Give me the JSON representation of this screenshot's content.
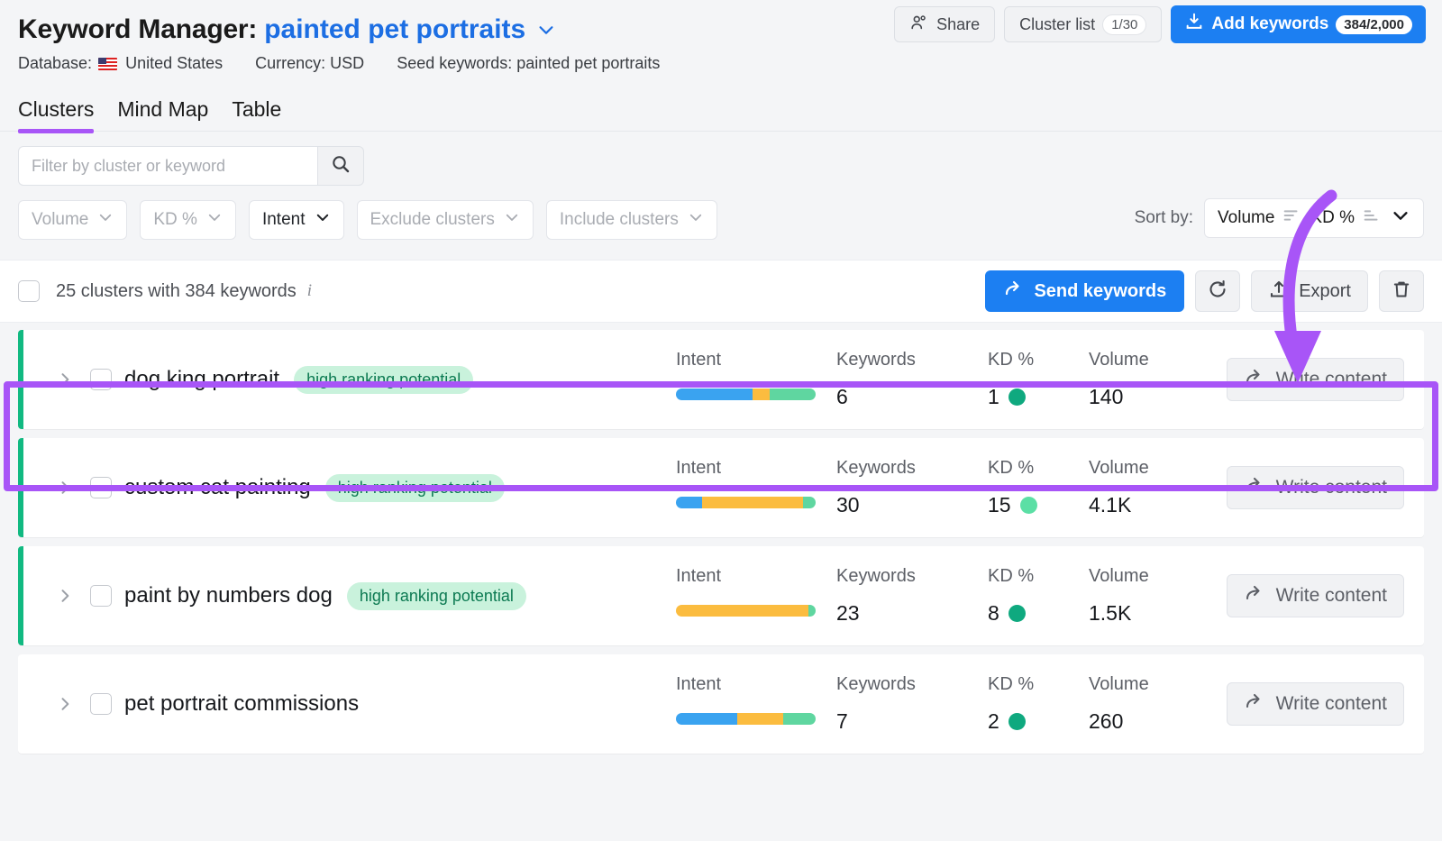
{
  "header": {
    "title": "Keyword Manager:",
    "project": "painted pet portraits",
    "chevron_icon": "chevron-down-icon",
    "share_label": "Share",
    "share_icon": "people-icon",
    "cluster_list_label": "Cluster list",
    "cluster_list_count": "1/30",
    "add_keywords_label": "Add keywords",
    "add_keywords_count": "384/2,000",
    "add_keywords_icon": "download-icon",
    "meta": {
      "database_label": "Database:",
      "database_value": "United States",
      "currency": "Currency: USD",
      "seed": "Seed keywords: painted pet portraits"
    }
  },
  "tabs": [
    {
      "label": "Clusters",
      "active": true
    },
    {
      "label": "Mind Map",
      "active": false
    },
    {
      "label": "Table",
      "active": false
    }
  ],
  "filters": {
    "search_placeholder": "Filter by cluster or keyword",
    "search_value": "",
    "search_icon": "search-icon",
    "chips": [
      {
        "label": "Volume",
        "enabled": false
      },
      {
        "label": "KD %",
        "enabled": false
      },
      {
        "label": "Intent",
        "enabled": true
      },
      {
        "label": "Exclude clusters",
        "enabled": false
      },
      {
        "label": "Include clusters",
        "enabled": false
      }
    ],
    "sort_by_label": "Sort by:",
    "sort_primary": "Volume",
    "sort_secondary": "KD %"
  },
  "toolbar": {
    "summary": "25 clusters with 384 keywords",
    "info_icon": "info-icon",
    "send_keywords_label": "Send keywords",
    "send_icon": "share-arrow-icon",
    "refresh_icon": "refresh-icon",
    "export_label": "Export",
    "export_icon": "upload-icon",
    "delete_icon": "trash-icon"
  },
  "columns": {
    "intent": "Intent",
    "keywords": "Keywords",
    "kd": "KD %",
    "volume": "Volume"
  },
  "write_content_label": "Write content",
  "colors": {
    "accent_purple": "#a855f7",
    "brand_blue": "#1c7ff2",
    "accent_green": "#11b981",
    "intent_informational": "#3aa3f0",
    "intent_commercial": "#fbbc3f",
    "intent_transactional": "#5fd6a0",
    "kd_easy": "#0fa97f",
    "kd_very_easy": "#5bdfa5",
    "badge_bg": "#c9f2dc",
    "badge_text": "#0c7a52"
  },
  "clusters": [
    {
      "name": "dog king portrait",
      "badge": "high ranking potential",
      "has_accent": true,
      "keywords": "6",
      "kd": "1",
      "kd_color": "#0fa97f",
      "volume": "140",
      "intent": [
        {
          "type": "informational",
          "pct": 55,
          "color": "#3aa3f0"
        },
        {
          "type": "commercial",
          "pct": 12,
          "color": "#fbbc3f"
        },
        {
          "type": "transactional",
          "pct": 33,
          "color": "#5fd6a0"
        }
      ]
    },
    {
      "name": "custom cat painting",
      "badge": "high ranking potential",
      "has_accent": true,
      "keywords": "30",
      "kd": "15",
      "kd_color": "#5bdfa5",
      "volume": "4.1K",
      "intent": [
        {
          "type": "informational",
          "pct": 19,
          "color": "#3aa3f0"
        },
        {
          "type": "commercial",
          "pct": 72,
          "color": "#fbbc3f"
        },
        {
          "type": "transactional",
          "pct": 9,
          "color": "#5fd6a0"
        }
      ]
    },
    {
      "name": "paint by numbers dog",
      "badge": "high ranking potential",
      "has_accent": true,
      "keywords": "23",
      "kd": "8",
      "kd_color": "#0fa97f",
      "volume": "1.5K",
      "intent": [
        {
          "type": "informational",
          "pct": 0,
          "color": "#3aa3f0"
        },
        {
          "type": "commercial",
          "pct": 95,
          "color": "#fbbc3f"
        },
        {
          "type": "transactional",
          "pct": 5,
          "color": "#5fd6a0"
        }
      ]
    },
    {
      "name": "pet portrait commissions",
      "badge": "",
      "has_accent": false,
      "keywords": "7",
      "kd": "2",
      "kd_color": "#0fa97f",
      "volume": "260",
      "intent": [
        {
          "type": "informational",
          "pct": 44,
          "color": "#3aa3f0"
        },
        {
          "type": "commercial",
          "pct": 33,
          "color": "#fbbc3f"
        },
        {
          "type": "transactional",
          "pct": 23,
          "color": "#5fd6a0"
        }
      ]
    }
  ],
  "annotations": {
    "highlight_target": "dog king portrait",
    "arrow_icon": "curved-arrow-down-icon"
  }
}
